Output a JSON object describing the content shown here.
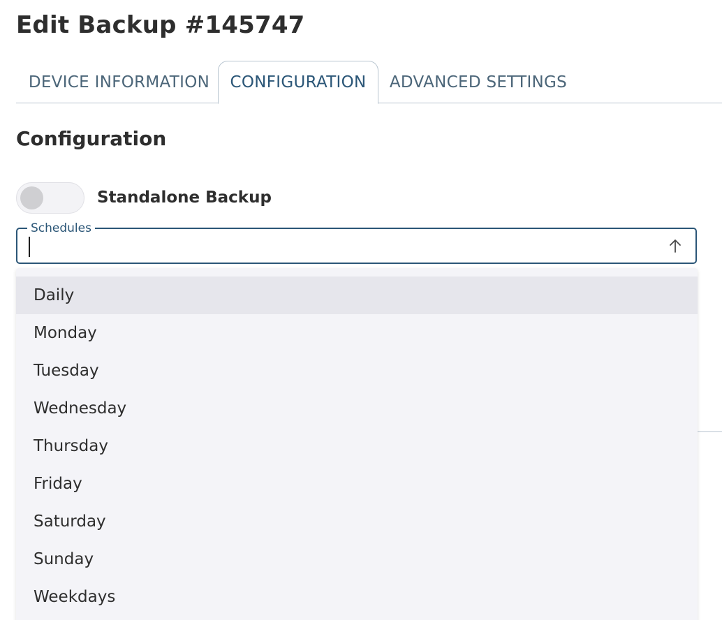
{
  "page": {
    "title": "Edit Backup #145747"
  },
  "tabs": [
    {
      "label": "DEVICE INFORMATION",
      "active": false
    },
    {
      "label": "CONFIGURATION",
      "active": true
    },
    {
      "label": "ADVANCED SETTINGS",
      "active": false
    }
  ],
  "section": {
    "title": "Configuration"
  },
  "toggle": {
    "label": "Standalone Backup",
    "checked": false
  },
  "schedules": {
    "label": "Schedules",
    "value": "",
    "open": true,
    "options": [
      {
        "label": "Daily",
        "highlighted": true
      },
      {
        "label": "Monday",
        "highlighted": false
      },
      {
        "label": "Tuesday",
        "highlighted": false
      },
      {
        "label": "Wednesday",
        "highlighted": false
      },
      {
        "label": "Thursday",
        "highlighted": false
      },
      {
        "label": "Friday",
        "highlighted": false
      },
      {
        "label": "Saturday",
        "highlighted": false
      },
      {
        "label": "Sunday",
        "highlighted": false
      },
      {
        "label": "Weekdays",
        "highlighted": false
      }
    ]
  },
  "colors": {
    "accent": "#2b5677",
    "tab_text": "#4c6679",
    "menu_bg": "#f4f4f8",
    "menu_highlight": "#e6e6ec"
  },
  "icons": {
    "dropdown_toggle": "arrow-up-icon"
  }
}
